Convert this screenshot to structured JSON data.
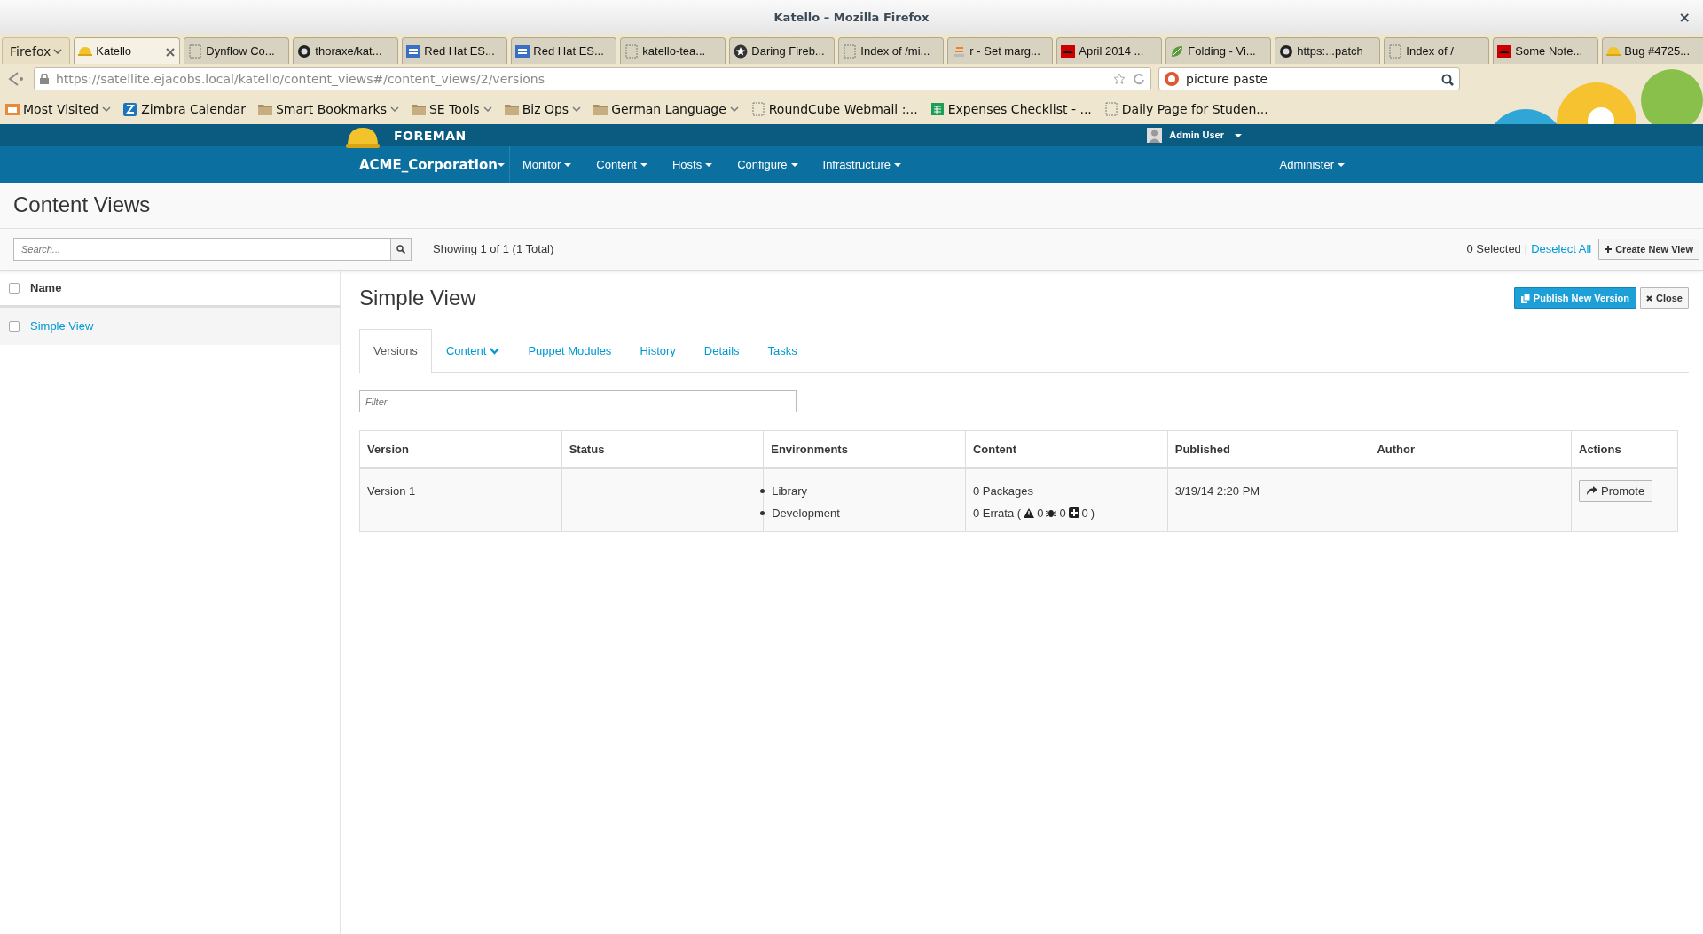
{
  "window": {
    "title": "Katello – Mozilla Firefox",
    "close": "×"
  },
  "browser": {
    "menu_button": "Firefox",
    "tabs": [
      {
        "label": "Katello",
        "kind": "helmet",
        "selected": true
      },
      {
        "label": "Dynflow Co...",
        "kind": "blank",
        "selected": false
      },
      {
        "label": "thoraxe/kat...",
        "kind": "github",
        "selected": false
      },
      {
        "label": "Red Hat ES...",
        "kind": "ep",
        "selected": false
      },
      {
        "label": "Red Hat ES...",
        "kind": "ep",
        "selected": false
      },
      {
        "label": "katello-tea...",
        "kind": "blank",
        "selected": false
      },
      {
        "label": "Daring Fireb...",
        "kind": "star",
        "selected": false
      },
      {
        "label": "Index of /mi...",
        "kind": "blank",
        "selected": false
      },
      {
        "label": "r - Set marg...",
        "kind": "stack",
        "selected": false
      },
      {
        "label": "April 2014 ...",
        "kind": "redhat",
        "selected": false
      },
      {
        "label": "Folding - Vi...",
        "kind": "leaf",
        "selected": false
      },
      {
        "label": "https:...patch",
        "kind": "github",
        "selected": false
      },
      {
        "label": "Index of /",
        "kind": "blank",
        "selected": false
      },
      {
        "label": "Some Note...",
        "kind": "redhat",
        "selected": false
      },
      {
        "label": "Bug #4725...",
        "kind": "helmet",
        "selected": false
      }
    ],
    "url": "https://satellite.ejacobs.local/katello/content_views#/content_views/2/versions",
    "search_value": "picture paste",
    "bookmarks": [
      {
        "label": "Most Visited",
        "kind": "mostvisited",
        "dropdown": true
      },
      {
        "label": "Zimbra Calendar",
        "kind": "zimbra",
        "dropdown": false
      },
      {
        "label": "Smart Bookmarks",
        "kind": "folder",
        "dropdown": true
      },
      {
        "label": "SE Tools",
        "kind": "folder",
        "dropdown": true
      },
      {
        "label": "Biz Ops",
        "kind": "folder",
        "dropdown": true
      },
      {
        "label": "German Language",
        "kind": "folder",
        "dropdown": true
      },
      {
        "label": "RoundCube Webmail :...",
        "kind": "blank",
        "dropdown": false
      },
      {
        "label": "Expenses Checklist - ...",
        "kind": "sheet",
        "dropdown": false
      },
      {
        "label": "Daily Page for Studen...",
        "kind": "blank",
        "dropdown": false
      }
    ]
  },
  "app": {
    "brand": "FOREMAN",
    "user": "Admin User",
    "organization": "ACME_Corporation",
    "menus": [
      "Monitor",
      "Content",
      "Hosts",
      "Configure",
      "Infrastructure"
    ],
    "right_menu": "Administer"
  },
  "page": {
    "title": "Content Views",
    "search_placeholder": "Search...",
    "showing": "Showing 1 of 1 (1 Total)",
    "selected_count": "0 Selected",
    "separator": "|",
    "deselect_all": "Deselect All",
    "create_button": "Create New View"
  },
  "list": {
    "header": "Name",
    "header_checked": false,
    "rows": [
      {
        "name": "Simple View",
        "checked": false,
        "selected": true
      }
    ]
  },
  "detail": {
    "title": "Simple View",
    "publish_button": "Publish New Version",
    "close_button": "Close",
    "tabs": [
      {
        "label": "Versions",
        "selected": true,
        "dropdown": false
      },
      {
        "label": "Content",
        "selected": false,
        "dropdown": true
      },
      {
        "label": "Puppet Modules",
        "selected": false,
        "dropdown": false
      },
      {
        "label": "History",
        "selected": false,
        "dropdown": false
      },
      {
        "label": "Details",
        "selected": false,
        "dropdown": false
      },
      {
        "label": "Tasks",
        "selected": false,
        "dropdown": false
      }
    ],
    "filter_placeholder": "Filter",
    "table": {
      "columns": [
        "Version",
        "Status",
        "Environments",
        "Content",
        "Published",
        "Author",
        "Actions"
      ],
      "rows": [
        {
          "version": "Version 1",
          "environments": [
            "Library",
            "Development"
          ],
          "packages": "0 Packages",
          "errata": "0 Errata (",
          "security": "0",
          "bugfix": "0",
          "enhancement": "0",
          "errata_end": ")",
          "published": "3/19/14 2:20 PM",
          "action": "Promote"
        }
      ]
    }
  }
}
